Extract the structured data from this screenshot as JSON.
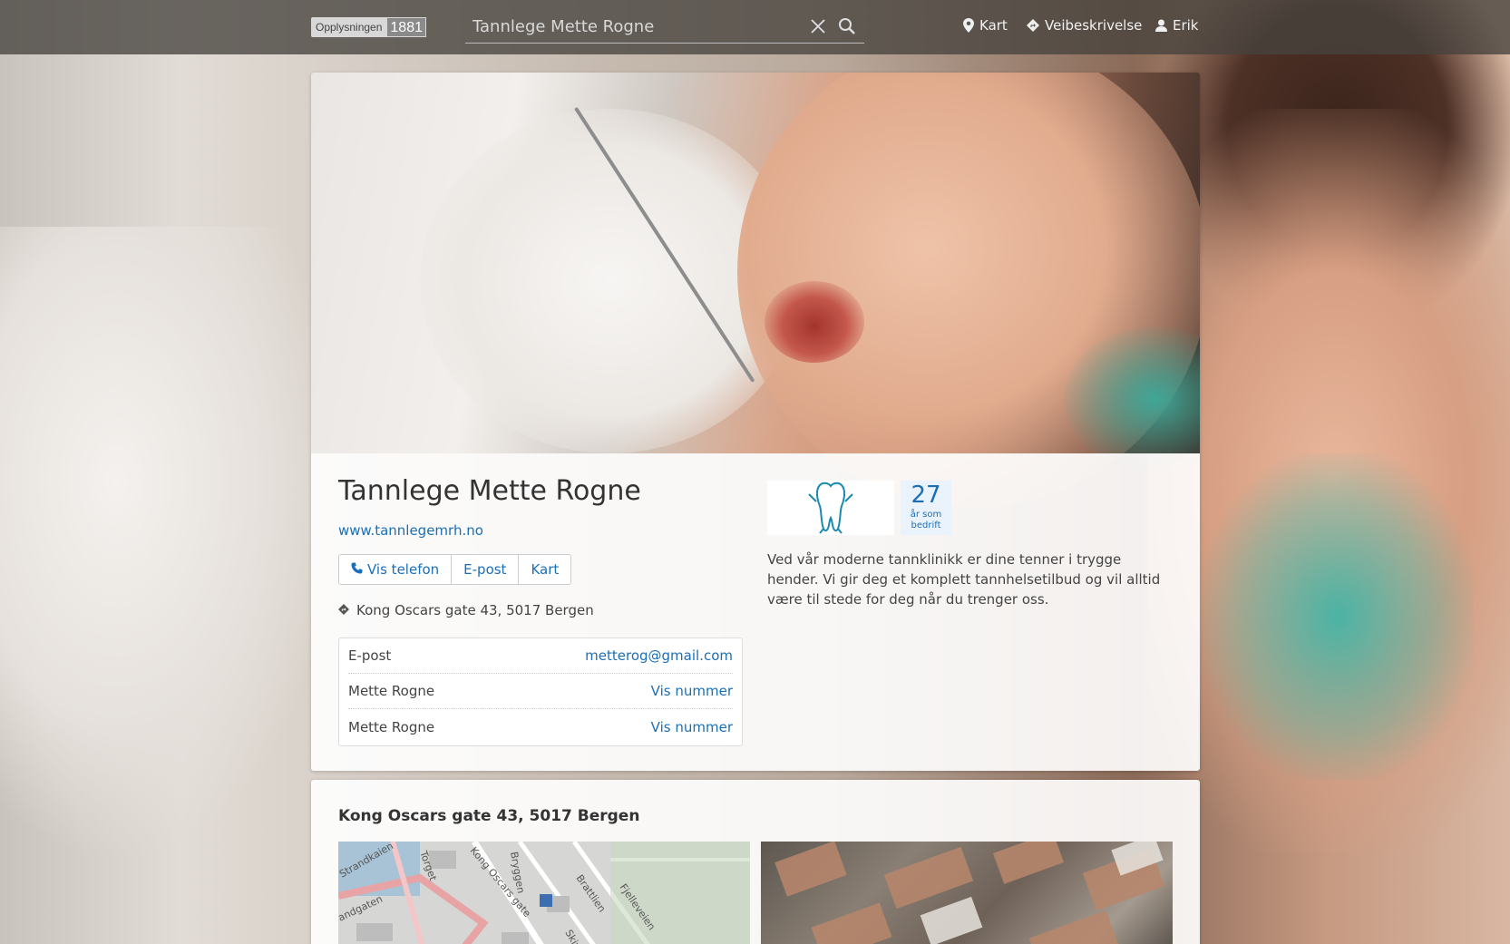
{
  "topbar": {
    "logo_text": "Opplysningen",
    "logo_number": "1881",
    "search_value": "Tannlege Mette Rogne",
    "nav": [
      {
        "label": "Kart",
        "icon": "map-pin-icon"
      },
      {
        "label": "Veibeskrivelse",
        "icon": "directions-icon"
      },
      {
        "label": "Erik",
        "icon": "user-icon"
      }
    ]
  },
  "business": {
    "name": "Tannlege Mette Rogne",
    "website": "www.tannlegemrh.no",
    "buttons": {
      "phone": "Vis telefon",
      "email": "E-post",
      "map": "Kart"
    },
    "address": "Kong Oscars gate 43, 5017 Bergen",
    "contacts": [
      {
        "label": "E-post",
        "value": "metterog@gmail.com"
      },
      {
        "label": "Mette Rogne",
        "value": "Vis nummer"
      },
      {
        "label": "Mette Rogne",
        "value": "Vis nummer"
      }
    ],
    "years": "27",
    "years_label_1": "år som",
    "years_label_2": "bedrift",
    "description": "Ved vår moderne tannklinikk er dine tenner i trygge hender. Vi gir deg et komplett tannhelsetilbud og vil alltid være til stede for deg når du trenger oss."
  },
  "location": {
    "heading": "Kong Oscars gate 43, 5017 Bergen",
    "map_streets": [
      "Strandkaien",
      "Torget",
      "Kong Oscars gate",
      "Bryggen",
      "Brattlien",
      "Fjelleveien",
      "Skivebakken",
      "andgaten"
    ]
  },
  "colors": {
    "link": "#1a6fb8",
    "topbar": "#46423e",
    "marker": "#f07a2d"
  }
}
